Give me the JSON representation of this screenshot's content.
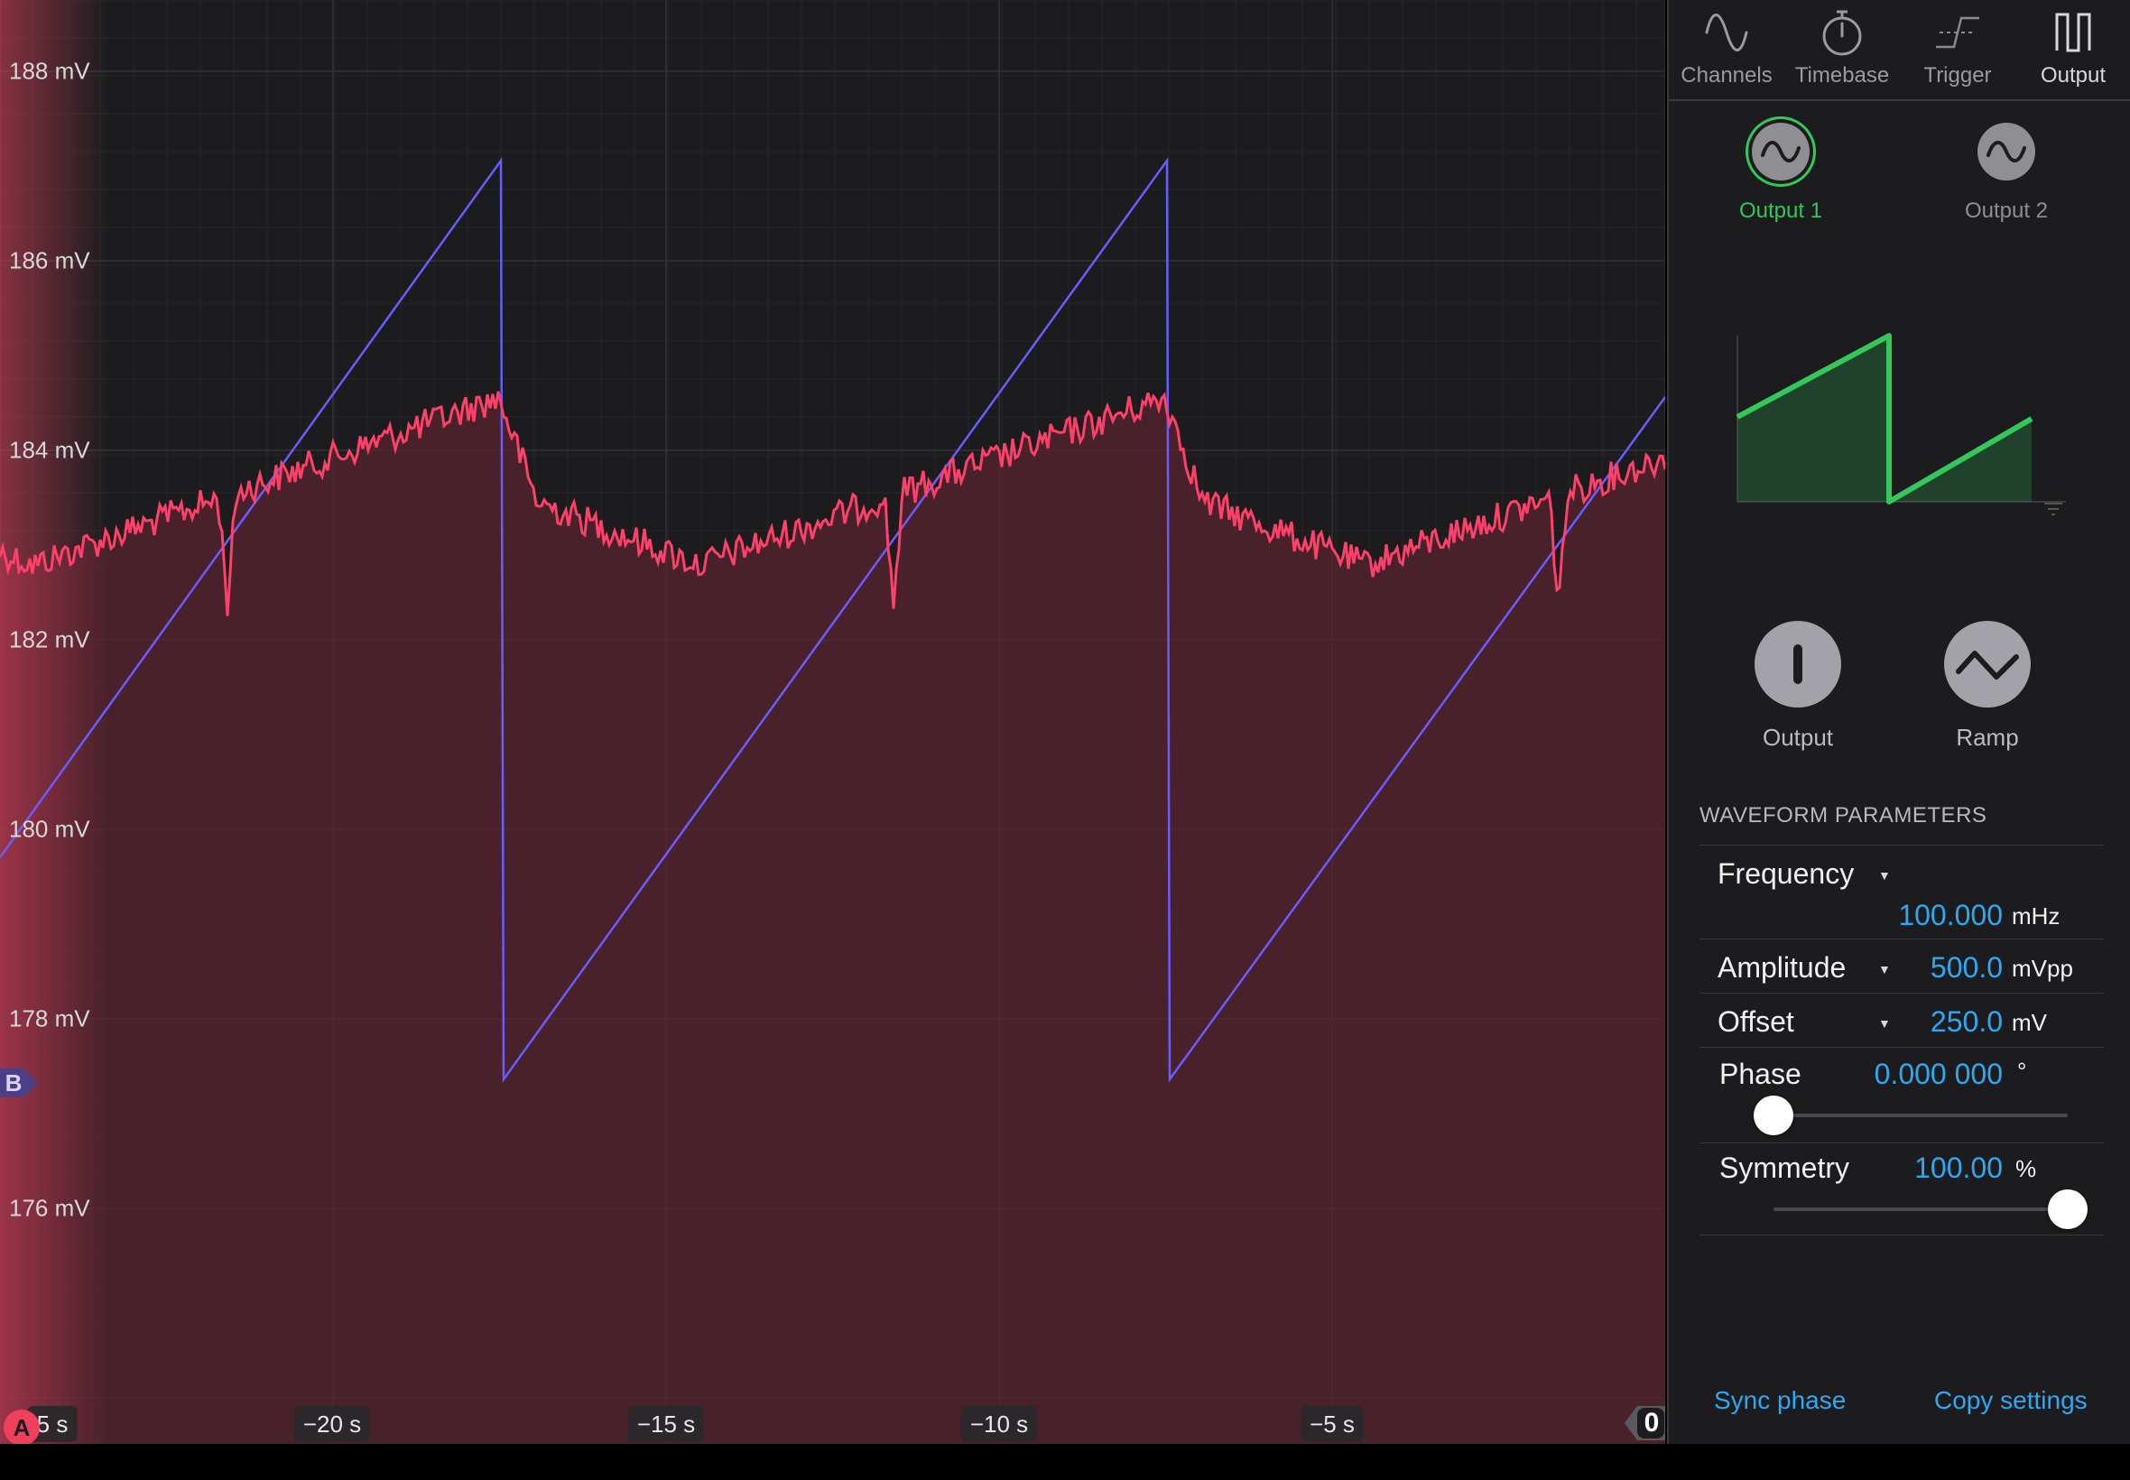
{
  "scope": {
    "y_labels": [
      "188 mV",
      "186 mV",
      "184 mV",
      "182 mV",
      "180 mV",
      "178 mV",
      "176 mV"
    ],
    "x_labels": [
      "5 s",
      "−20 s",
      "−15 s",
      "−10 s",
      "−5 s"
    ],
    "marker_a": "A",
    "marker_b": "B",
    "marker_zero": "0",
    "colors": {
      "channel_a": "#ff4068",
      "channel_b": "#6a5cff",
      "background": "#1c1c1e"
    }
  },
  "tabs": [
    {
      "label": "Channels",
      "icon": "sine-wave-icon"
    },
    {
      "label": "Timebase",
      "icon": "stopwatch-icon"
    },
    {
      "label": "Trigger",
      "icon": "trigger-edge-icon"
    },
    {
      "label": "Output",
      "icon": "pulse-output-icon",
      "active": true
    }
  ],
  "outputs": [
    {
      "label": "Output 1",
      "icon": "sine-icon",
      "active": true
    },
    {
      "label": "Output 2",
      "icon": "sine-icon",
      "active": false
    }
  ],
  "controls": {
    "output_button": {
      "label": "Output",
      "icon": "power-icon"
    },
    "waveform_button": {
      "label": "Ramp",
      "icon": "ramp-wave-icon"
    }
  },
  "parameters": {
    "title": "WAVEFORM PARAMETERS",
    "frequency": {
      "label": "Frequency",
      "value": "100.000",
      "unit": "mHz"
    },
    "amplitude": {
      "label": "Amplitude",
      "value": "500.0",
      "unit": "mVpp"
    },
    "offset": {
      "label": "Offset",
      "value": "250.0",
      "unit": "mV"
    },
    "phase": {
      "label": "Phase",
      "value": "0.000 000",
      "unit": "°",
      "slider_fraction": 0.0
    },
    "symmetry": {
      "label": "Symmetry",
      "value": "100.00",
      "unit": "%",
      "slider_fraction": 1.0
    }
  },
  "footer": {
    "sync_phase": "Sync phase",
    "copy_settings": "Copy settings"
  }
}
